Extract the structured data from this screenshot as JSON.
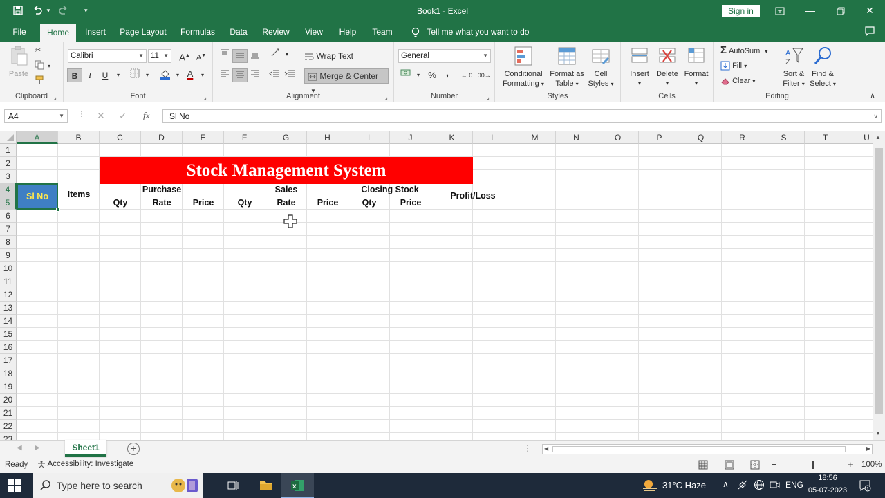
{
  "window": {
    "title": "Book1  -  Excel",
    "sign_in": "Sign in"
  },
  "tabs": [
    "File",
    "Home",
    "Insert",
    "Page Layout",
    "Formulas",
    "Data",
    "Review",
    "View",
    "Help",
    "Team"
  ],
  "tell_me": "Tell me what you want to do",
  "ribbon": {
    "clipboard": {
      "label": "Clipboard",
      "paste": "Paste"
    },
    "font": {
      "label": "Font",
      "name": "Calibri",
      "size": "11"
    },
    "alignment": {
      "label": "Alignment",
      "wrap_text": "Wrap Text",
      "merge_center": "Merge & Center"
    },
    "number": {
      "label": "Number",
      "format": "General",
      "percent": "%",
      "comma": ","
    },
    "styles": {
      "label": "Styles",
      "conditional_1": "Conditional",
      "conditional_2": "Formatting",
      "format_table_1": "Format as",
      "format_table_2": "Table",
      "cell_styles_1": "Cell",
      "cell_styles_2": "Styles"
    },
    "cells": {
      "label": "Cells",
      "insert": "Insert",
      "delete": "Delete",
      "format": "Format"
    },
    "editing": {
      "label": "Editing",
      "autosum": "AutoSum",
      "fill": "Fill",
      "clear": "Clear",
      "sort_1": "Sort &",
      "sort_2": "Filter",
      "find_1": "Find &",
      "find_2": "Select"
    }
  },
  "formula_bar": {
    "name_box": "A4",
    "content": "Sl No"
  },
  "grid": {
    "columns": [
      "A",
      "B",
      "C",
      "D",
      "E",
      "F",
      "G",
      "H",
      "I",
      "J",
      "K",
      "L",
      "M",
      "N",
      "O",
      "P",
      "Q",
      "R",
      "S",
      "T",
      "U"
    ],
    "rows": [
      "1",
      "2",
      "3",
      "4",
      "5",
      "6",
      "7",
      "8",
      "9",
      "10",
      "11",
      "12",
      "13",
      "14",
      "15",
      "16",
      "17",
      "18",
      "19",
      "20",
      "21",
      "22",
      "23"
    ],
    "selected_column": "A",
    "selected_rows": [
      "4",
      "5"
    ]
  },
  "cells": {
    "title": "Stock Management System",
    "sl_no": "Sl No",
    "items": "Items",
    "purchase": "Purchase",
    "sales": "Sales",
    "closing_stock": "Closing Stock",
    "profit_loss": "Profit/Loss",
    "qty": "Qty",
    "rate": "Rate",
    "price": "Price"
  },
  "colors": {
    "excel_green": "#217346",
    "title_fill": "#ff0000",
    "selected_fill": "#3f7fc4",
    "selected_text": "#ffe74d"
  },
  "sheet_tab": "Sheet1",
  "status": {
    "ready": "Ready",
    "accessibility": "Accessibility: Investigate",
    "zoom": "100%"
  },
  "taskbar": {
    "search_placeholder": "Type here to search",
    "weather": "31°C  Haze",
    "lang": "ENG",
    "time": "18:56",
    "date": "05-07-2023"
  }
}
